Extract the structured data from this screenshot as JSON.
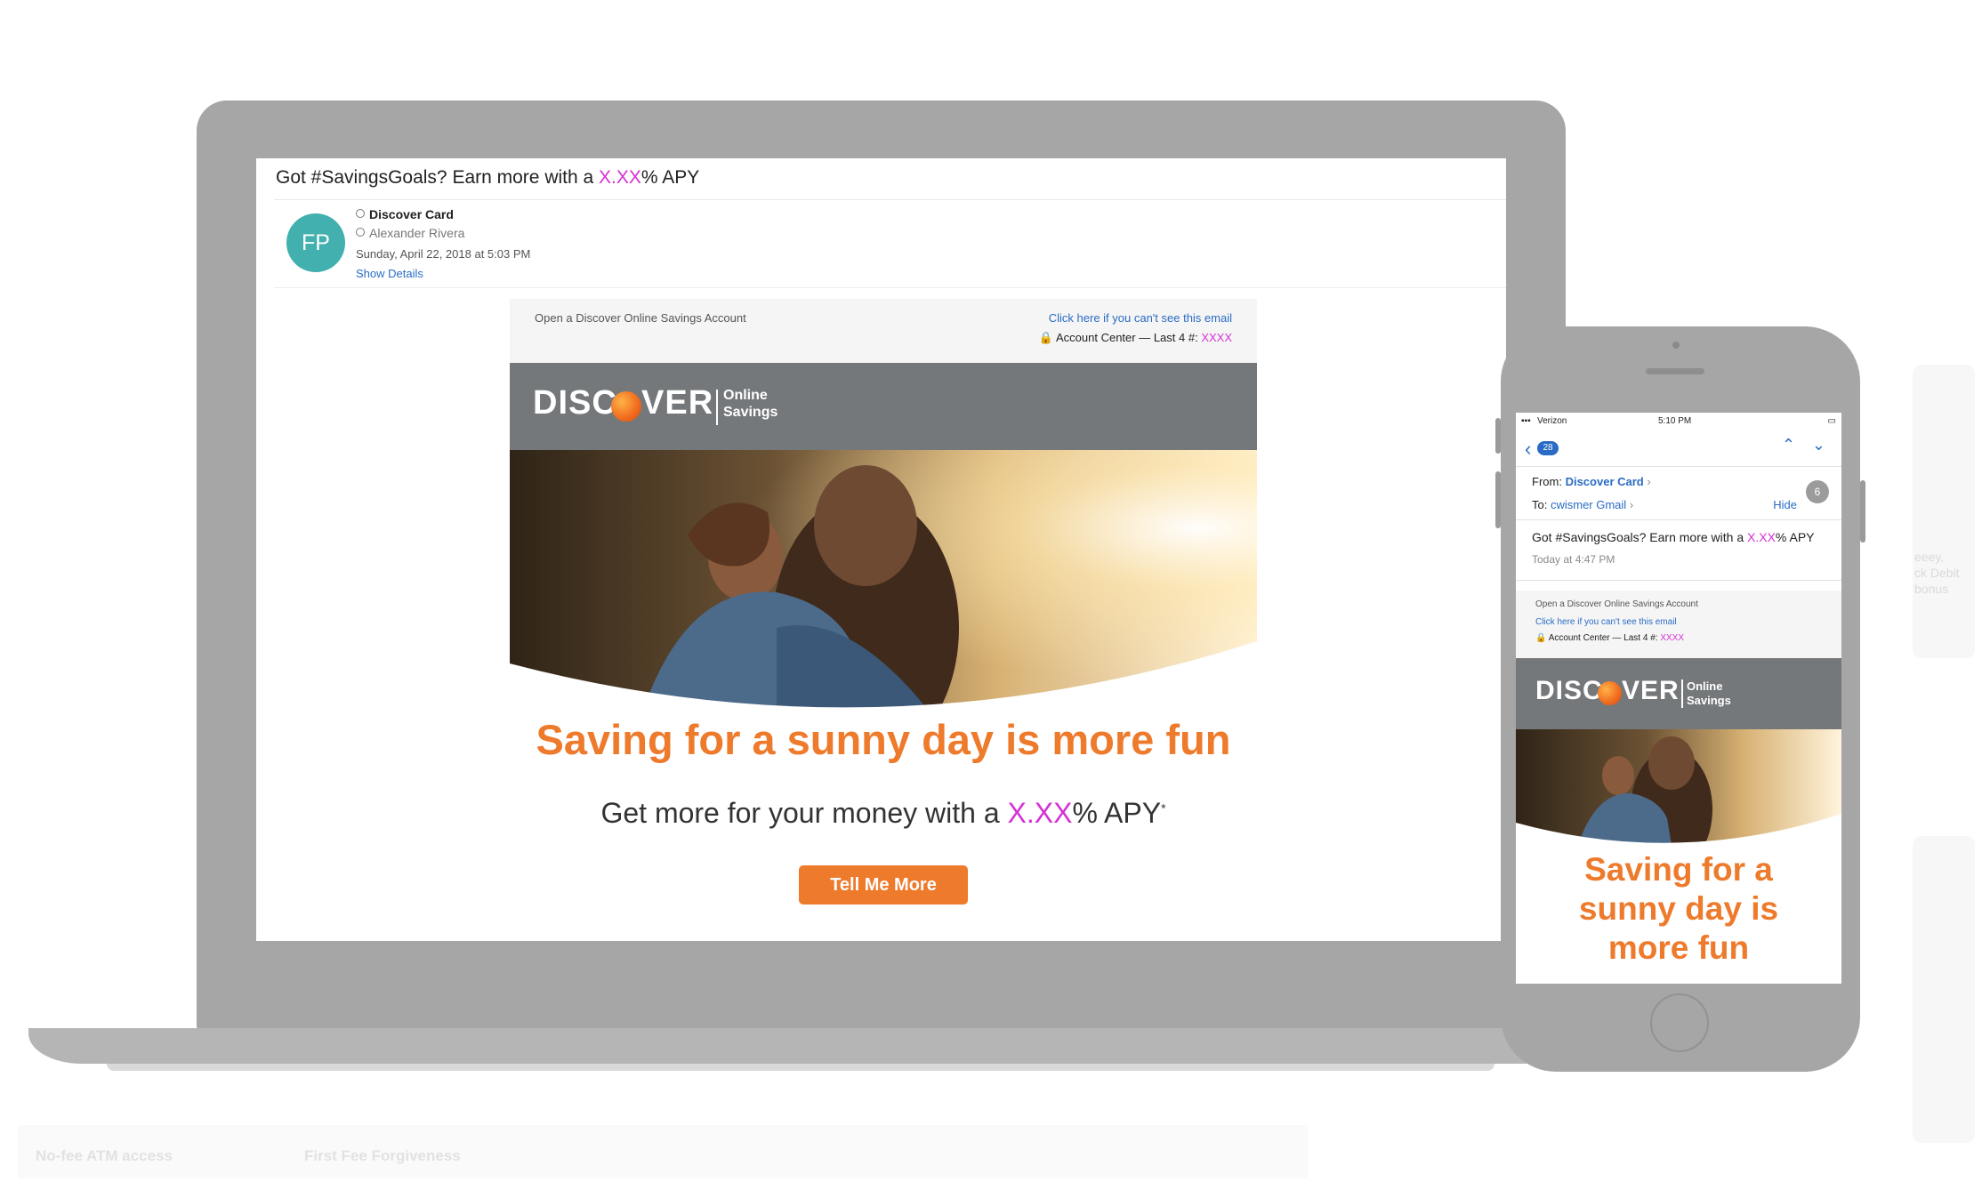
{
  "laptop": {
    "subject_prefix": "Got #SavingsGoals? Earn more with a ",
    "subject_placeholder": "X.XX",
    "subject_suffix": "% APY",
    "avatar_initials": "FP",
    "from_name": "Discover Card",
    "to_name": "Alexander Rivera",
    "date": "Sunday, April 22, 2018 at 5:03 PM",
    "show_details": "Show Details"
  },
  "email": {
    "header_left": "Open a Discover Online Savings Account",
    "header_link": "Click here if you can't see this email",
    "account_prefix": "Account Center — Last 4 #: ",
    "account_placeholder": "XXXX",
    "logo_word_left": "DISC",
    "logo_word_right": "VER",
    "logo_sub_1": "Online",
    "logo_sub_2": "Savings",
    "headline": "Saving for a sunny day is more fun",
    "subline_prefix": "Get more for your money with a ",
    "subline_placeholder": "X.XX",
    "subline_suffix": "% APY",
    "subline_mark": "*",
    "cta": "Tell Me More"
  },
  "phone": {
    "carrier": "Verizon",
    "time": "5:10 PM",
    "back_count": "28",
    "from_label": "From:",
    "from_name": "Discover Card",
    "to_label": "To:",
    "to_name": "cwismer Gmail",
    "hide": "Hide",
    "badge": "6",
    "subject_prefix": "Got #SavingsGoals? Earn more with a ",
    "subject_placeholder": "X.XX",
    "subject_suffix": "% APY",
    "received": "Today at 4:47 PM",
    "header_left": "Open a Discover Online Savings Account",
    "header_link": "Click here if you can't see this email",
    "account_prefix": "Account Center — Last 4 #: ",
    "account_placeholder": "XXXX",
    "headline_1": "Saving for a",
    "headline_2": "sunny day is",
    "headline_3": "more fun"
  },
  "background": {
    "feature_1": "No-fee ATM access",
    "feature_2": "First Fee Forgiveness",
    "side_1": "eeey,",
    "side_2": "ck Debit",
    "side_3": "bonus"
  },
  "colors": {
    "brand_orange": "#ee7a2c",
    "placeholder_magenta": "#d531d3",
    "link_blue": "#2a6cc4",
    "logo_bar_gray": "#75787a",
    "avatar_teal": "#41b0ae"
  }
}
